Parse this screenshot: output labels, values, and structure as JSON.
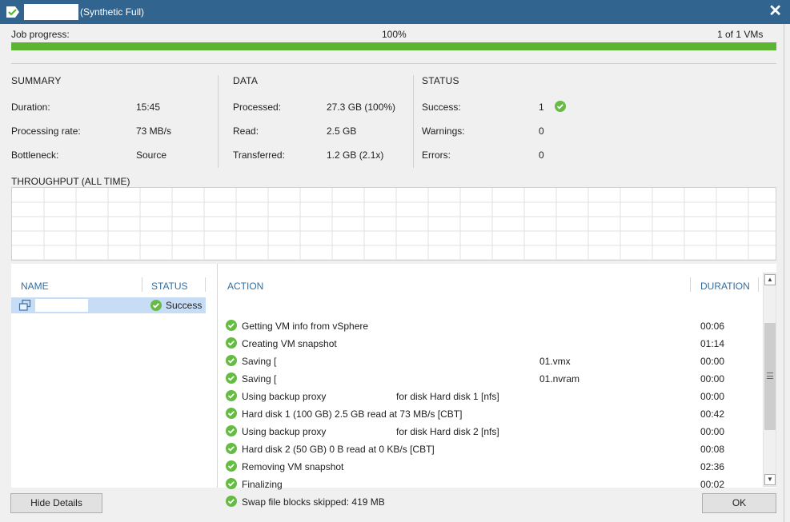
{
  "window": {
    "title": "(Synthetic Full)",
    "close_label": "✕"
  },
  "progress": {
    "label": "Job progress:",
    "percent_text": "100%",
    "percent_value": 100,
    "vms_text": "1 of 1 VMs",
    "color": "#5cb532"
  },
  "summary": {
    "title": "SUMMARY",
    "rows": [
      {
        "label": "Duration:",
        "value": "15:45"
      },
      {
        "label": "Processing rate:",
        "value": "73 MB/s"
      },
      {
        "label": "Bottleneck:",
        "value": "Source"
      }
    ]
  },
  "data_section": {
    "title": "DATA",
    "rows": [
      {
        "label": "Processed:",
        "value": "27.3 GB (100%)"
      },
      {
        "label": "Read:",
        "value": "2.5 GB"
      },
      {
        "label": "Transferred:",
        "value": "1.2 GB (2.1x)"
      }
    ]
  },
  "status_section": {
    "title": "STATUS",
    "rows": [
      {
        "label": "Success:",
        "value": "1",
        "icon": "check-circle-icon"
      },
      {
        "label": "Warnings:",
        "value": "0"
      },
      {
        "label": "Errors:",
        "value": "0"
      }
    ]
  },
  "throughput": {
    "title": "THROUGHPUT (ALL TIME)"
  },
  "vm_list": {
    "headers": {
      "name": "NAME",
      "status": "STATUS"
    },
    "items": [
      {
        "status": "Success",
        "icon": "vm-icon"
      }
    ]
  },
  "actions": {
    "headers": {
      "action": "ACTION",
      "duration": "DURATION"
    },
    "rows": [
      {
        "text": "Getting VM info from vSphere",
        "duration": "00:06"
      },
      {
        "text": "Creating VM snapshot",
        "duration": "01:14"
      },
      {
        "text": "Saving [",
        "text2": "01.vmx",
        "duration": "00:00"
      },
      {
        "text": "Saving [",
        "text2": "01.nvram",
        "duration": "00:00"
      },
      {
        "text": "Using backup proxy",
        "text2": "for disk Hard disk 1 [nfs]",
        "duration": "00:00"
      },
      {
        "text": "Hard disk 1 (100 GB) 2.5 GB read at 73 MB/s [CBT]",
        "duration": "00:42"
      },
      {
        "text": "Using backup proxy",
        "text2": "for disk Hard disk 2 [nfs]",
        "duration": "00:00"
      },
      {
        "text": "Hard disk 2 (50 GB) 0 B read at 0 KB/s [CBT]",
        "duration": "00:08"
      },
      {
        "text": "Removing VM snapshot",
        "duration": "02:36"
      },
      {
        "text": "Finalizing",
        "duration": "00:02"
      },
      {
        "text": "Swap file blocks skipped: 419 MB",
        "duration": ""
      }
    ]
  },
  "buttons": {
    "hide_details": "Hide Details",
    "ok": "OK"
  },
  "colors": {
    "titlebar": "#31648e",
    "accent_blue": "#2f6fa5",
    "success_green": "#66bb44",
    "selection": "#c7ddf6"
  }
}
